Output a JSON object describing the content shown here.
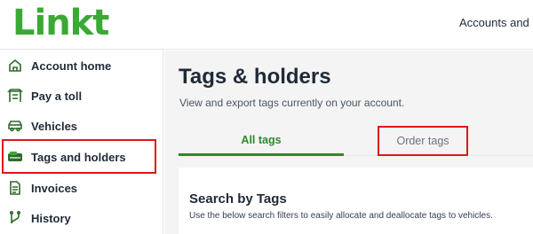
{
  "brand": {
    "logo_text": "Linkt",
    "color": "#3aa935"
  },
  "header": {
    "nav_text": "Accounts and p"
  },
  "sidebar": {
    "items": [
      {
        "label": "Account home",
        "icon": "home-icon"
      },
      {
        "label": "Pay a toll",
        "icon": "toll-gate-icon"
      },
      {
        "label": "Vehicles",
        "icon": "car-icon"
      },
      {
        "label": "Tags and holders",
        "icon": "tag-holder-icon",
        "highlighted": true
      },
      {
        "label": "Invoices",
        "icon": "document-icon"
      },
      {
        "label": "History",
        "icon": "history-icon"
      }
    ]
  },
  "main": {
    "title": "Tags & holders",
    "subtitle": "View and export tags currently on your account.",
    "tabs": [
      {
        "label": "All tags",
        "active": true
      },
      {
        "label": "Order tags",
        "active": false,
        "highlighted": true
      }
    ],
    "search_card": {
      "title": "Search by Tags",
      "description": "Use the below search filters to easily allocate and deallocate tags to vehicles."
    }
  },
  "colors": {
    "accent_green": "#2d8a2a",
    "highlight_red": "#e0161b"
  }
}
